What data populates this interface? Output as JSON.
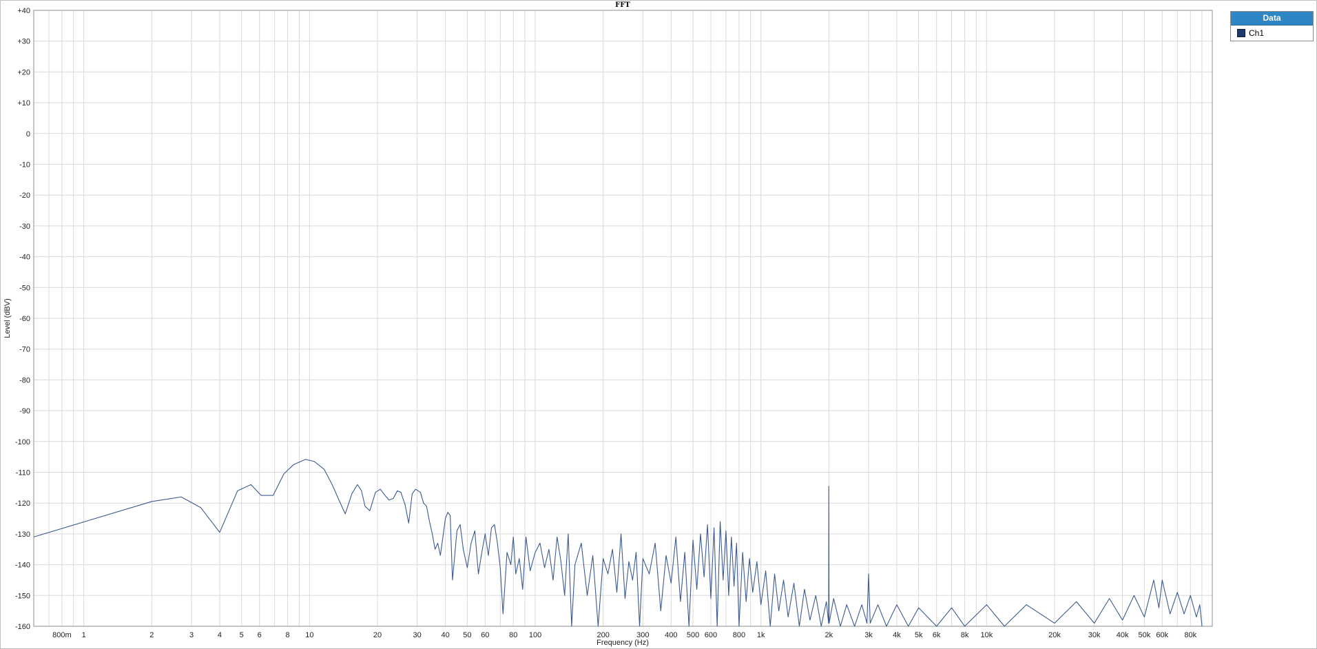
{
  "chart_data": {
    "type": "line",
    "title": "FFT",
    "xlabel": "Frequency (Hz)",
    "ylabel": "Level (dBV)",
    "xscale": "log",
    "xlim": [
      0.6,
      100000
    ],
    "ylim": [
      -160,
      40
    ],
    "grid": true,
    "legend_title": "Data",
    "legend_position": "top-right",
    "x_tick_labels": [
      {
        "v": 0.8,
        "t": "800m"
      },
      {
        "v": 1,
        "t": "1"
      },
      {
        "v": 2,
        "t": "2"
      },
      {
        "v": 3,
        "t": "3"
      },
      {
        "v": 4,
        "t": "4"
      },
      {
        "v": 5,
        "t": "5"
      },
      {
        "v": 6,
        "t": "6"
      },
      {
        "v": 8,
        "t": "8"
      },
      {
        "v": 10,
        "t": "10"
      },
      {
        "v": 20,
        "t": "20"
      },
      {
        "v": 30,
        "t": "30"
      },
      {
        "v": 40,
        "t": "40"
      },
      {
        "v": 50,
        "t": "50"
      },
      {
        "v": 60,
        "t": "60"
      },
      {
        "v": 80,
        "t": "80"
      },
      {
        "v": 100,
        "t": "100"
      },
      {
        "v": 200,
        "t": "200"
      },
      {
        "v": 300,
        "t": "300"
      },
      {
        "v": 400,
        "t": "400"
      },
      {
        "v": 500,
        "t": "500"
      },
      {
        "v": 600,
        "t": "600"
      },
      {
        "v": 800,
        "t": "800"
      },
      {
        "v": 1000,
        "t": "1k"
      },
      {
        "v": 2000,
        "t": "2k"
      },
      {
        "v": 3000,
        "t": "3k"
      },
      {
        "v": 4000,
        "t": "4k"
      },
      {
        "v": 5000,
        "t": "5k"
      },
      {
        "v": 6000,
        "t": "6k"
      },
      {
        "v": 8000,
        "t": "8k"
      },
      {
        "v": 10000,
        "t": "10k"
      },
      {
        "v": 20000,
        "t": "20k"
      },
      {
        "v": 30000,
        "t": "30k"
      },
      {
        "v": 40000,
        "t": "40k"
      },
      {
        "v": 50000,
        "t": "50k"
      },
      {
        "v": 60000,
        "t": "60k"
      },
      {
        "v": 80000,
        "t": "80k"
      }
    ],
    "y_tick_labels": [
      {
        "v": 40,
        "t": "+40"
      },
      {
        "v": 30,
        "t": "+30"
      },
      {
        "v": 20,
        "t": "+20"
      },
      {
        "v": 10,
        "t": "+10"
      },
      {
        "v": 0,
        "t": "0"
      },
      {
        "v": -10,
        "t": "-10"
      },
      {
        "v": -20,
        "t": "-20"
      },
      {
        "v": -30,
        "t": "-30"
      },
      {
        "v": -40,
        "t": "-40"
      },
      {
        "v": -50,
        "t": "-50"
      },
      {
        "v": -60,
        "t": "-60"
      },
      {
        "v": -70,
        "t": "-70"
      },
      {
        "v": -80,
        "t": "-80"
      },
      {
        "v": -90,
        "t": "-90"
      },
      {
        "v": -100,
        "t": "-100"
      },
      {
        "v": -110,
        "t": "-110"
      },
      {
        "v": -120,
        "t": "-120"
      },
      {
        "v": -130,
        "t": "-130"
      },
      {
        "v": -140,
        "t": "-140"
      },
      {
        "v": -150,
        "t": "-150"
      },
      {
        "v": -160,
        "t": "-160"
      }
    ],
    "series": [
      {
        "name": "Ch1",
        "color": "#3a5a8f",
        "points": [
          [
            0.6,
            -131
          ],
          [
            2.0,
            -119.5
          ],
          [
            2.7,
            -118
          ],
          [
            3.3,
            -121.5
          ],
          [
            4.0,
            -129.5
          ],
          [
            4.8,
            -116
          ],
          [
            5.5,
            -114
          ],
          [
            6.1,
            -117.5
          ],
          [
            6.9,
            -117.5
          ],
          [
            7.7,
            -110.5
          ],
          [
            8.5,
            -107.5
          ],
          [
            9.6,
            -105.8
          ],
          [
            10.5,
            -106.5
          ],
          [
            11.6,
            -109
          ],
          [
            12.6,
            -114
          ],
          [
            13.5,
            -119
          ],
          [
            14.4,
            -123.5
          ],
          [
            15.4,
            -117
          ],
          [
            16.3,
            -114
          ],
          [
            17.0,
            -116
          ],
          [
            17.6,
            -121
          ],
          [
            18.5,
            -122.5
          ],
          [
            19.6,
            -116.5
          ],
          [
            20.6,
            -115.5
          ],
          [
            21.6,
            -117.5
          ],
          [
            22.5,
            -119
          ],
          [
            23.5,
            -118.5
          ],
          [
            24.5,
            -116
          ],
          [
            25.4,
            -116.5
          ],
          [
            26.5,
            -120.5
          ],
          [
            27.5,
            -126.5
          ],
          [
            28.5,
            -117
          ],
          [
            29.5,
            -115.5
          ],
          [
            31.0,
            -116.5
          ],
          [
            32.0,
            -120
          ],
          [
            33.0,
            -121
          ],
          [
            34.0,
            -126
          ],
          [
            35.0,
            -130
          ],
          [
            36.0,
            -135
          ],
          [
            37.0,
            -133
          ],
          [
            38.0,
            -137
          ],
          [
            39.0,
            -131
          ],
          [
            40.0,
            -125
          ],
          [
            41.0,
            -123
          ],
          [
            42.0,
            -124
          ],
          [
            43.0,
            -145
          ],
          [
            44.0,
            -137
          ],
          [
            45.0,
            -129
          ],
          [
            46.5,
            -127
          ],
          [
            48.0,
            -135
          ],
          [
            50.0,
            -141
          ],
          [
            52.0,
            -133
          ],
          [
            54.0,
            -129
          ],
          [
            56.0,
            -143
          ],
          [
            58.0,
            -136
          ],
          [
            60.0,
            -130
          ],
          [
            62.0,
            -137
          ],
          [
            64.0,
            -128
          ],
          [
            66.0,
            -127
          ],
          [
            68.0,
            -133
          ],
          [
            70.0,
            -141
          ],
          [
            72.0,
            -156
          ],
          [
            75.0,
            -136
          ],
          [
            78.0,
            -140
          ],
          [
            80.0,
            -131
          ],
          [
            82.0,
            -143
          ],
          [
            85.0,
            -138
          ],
          [
            88.0,
            -148
          ],
          [
            91.0,
            -131
          ],
          [
            95.0,
            -142
          ],
          [
            100.0,
            -136
          ],
          [
            105.0,
            -133
          ],
          [
            110.0,
            -141
          ],
          [
            115.0,
            -135
          ],
          [
            120.0,
            -145
          ],
          [
            125.0,
            -131
          ],
          [
            130.0,
            -139
          ],
          [
            135.0,
            -150
          ],
          [
            140.0,
            -130
          ],
          [
            145.0,
            -160
          ],
          [
            150.0,
            -140
          ],
          [
            160.0,
            -133
          ],
          [
            170.0,
            -150
          ],
          [
            180.0,
            -137
          ],
          [
            190.0,
            -160
          ],
          [
            200.0,
            -138
          ],
          [
            210.0,
            -143
          ],
          [
            220.0,
            -135
          ],
          [
            230.0,
            -149
          ],
          [
            240.0,
            -130
          ],
          [
            250.0,
            -151
          ],
          [
            260.0,
            -139
          ],
          [
            270.0,
            -145
          ],
          [
            280.0,
            -136
          ],
          [
            290.0,
            -160
          ],
          [
            300.0,
            -138
          ],
          [
            320.0,
            -143
          ],
          [
            340.0,
            -133
          ],
          [
            360.0,
            -155
          ],
          [
            380.0,
            -137
          ],
          [
            400.0,
            -146
          ],
          [
            420.0,
            -131
          ],
          [
            440.0,
            -152
          ],
          [
            460.0,
            -136
          ],
          [
            480.0,
            -160
          ],
          [
            500.0,
            -132
          ],
          [
            520.0,
            -148
          ],
          [
            540.0,
            -130
          ],
          [
            560.0,
            -144
          ],
          [
            580.0,
            -127
          ],
          [
            600.0,
            -151
          ],
          [
            620.0,
            -128
          ],
          [
            640.0,
            -160
          ],
          [
            660.0,
            -126
          ],
          [
            680.0,
            -145
          ],
          [
            700.0,
            -129
          ],
          [
            720.0,
            -150
          ],
          [
            740.0,
            -131
          ],
          [
            760.0,
            -147
          ],
          [
            780.0,
            -133
          ],
          [
            800.0,
            -160
          ],
          [
            830.0,
            -136
          ],
          [
            860.0,
            -152
          ],
          [
            890.0,
            -138
          ],
          [
            920.0,
            -149
          ],
          [
            960.0,
            -139
          ],
          [
            1000.0,
            -153
          ],
          [
            1050.0,
            -142
          ],
          [
            1100.0,
            -160
          ],
          [
            1150.0,
            -143
          ],
          [
            1200.0,
            -155
          ],
          [
            1260.0,
            -145
          ],
          [
            1320.0,
            -157
          ],
          [
            1400.0,
            -146
          ],
          [
            1480.0,
            -160
          ],
          [
            1560.0,
            -148
          ],
          [
            1650.0,
            -158
          ],
          [
            1750.0,
            -150
          ],
          [
            1850.0,
            -160
          ],
          [
            1950.0,
            -152
          ],
          [
            1995.0,
            -159
          ],
          [
            2000.0,
            -114.5
          ],
          [
            2005.0,
            -159
          ],
          [
            2100.0,
            -151
          ],
          [
            2250.0,
            -160
          ],
          [
            2400.0,
            -153
          ],
          [
            2600.0,
            -160
          ],
          [
            2800.0,
            -153
          ],
          [
            2950.0,
            -159
          ],
          [
            3000.0,
            -143
          ],
          [
            3050.0,
            -159
          ],
          [
            3300.0,
            -153
          ],
          [
            3600.0,
            -160
          ],
          [
            4000.0,
            -153
          ],
          [
            4500.0,
            -160
          ],
          [
            5000.0,
            -154
          ],
          [
            6000.0,
            -160
          ],
          [
            7000.0,
            -154
          ],
          [
            8000.0,
            -160
          ],
          [
            10000.0,
            -153
          ],
          [
            12000.0,
            -160
          ],
          [
            15000.0,
            -153
          ],
          [
            20000.0,
            -159
          ],
          [
            25000.0,
            -152
          ],
          [
            30000.0,
            -159
          ],
          [
            35000.0,
            -151
          ],
          [
            40000.0,
            -158
          ],
          [
            45000.0,
            -150
          ],
          [
            50000.0,
            -157
          ],
          [
            55000.0,
            -145
          ],
          [
            58000.0,
            -154
          ],
          [
            60000.0,
            -145
          ],
          [
            65000.0,
            -156
          ],
          [
            70000.0,
            -149
          ],
          [
            75000.0,
            -156
          ],
          [
            80000.0,
            -150
          ],
          [
            85000.0,
            -157
          ],
          [
            88000.0,
            -153
          ],
          [
            90000.0,
            -160
          ]
        ]
      }
    ]
  },
  "legend": {
    "title": "Data",
    "items": [
      {
        "label": "Ch1",
        "color": "#1f3a6d"
      }
    ]
  }
}
